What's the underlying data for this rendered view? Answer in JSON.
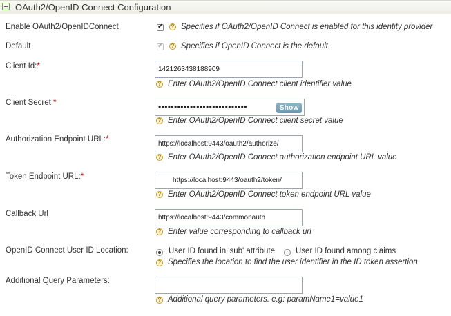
{
  "section": {
    "title": "OAuth2/OpenID Connect Configuration"
  },
  "enable": {
    "label": "Enable OAuth2/OpenIDConnect",
    "checked": true,
    "help": "Specifies if OAuth2/OpenID Connect is enabled for this identity provider"
  },
  "default": {
    "label": "Default",
    "checked": true,
    "disabled": true,
    "help": "Specifies if OpenID Connect is the default"
  },
  "client_id": {
    "label": "Client Id:",
    "required_mark": "*",
    "value": "1421263438188909",
    "help": "Enter OAuth2/OpenID Connect client identifier value"
  },
  "client_secret": {
    "label": "Client Secret:",
    "required_mark": "*",
    "masked_value": "••••••••••••••••••••••••••••",
    "show_label": "Show",
    "help": "Enter OAuth2/OpenID Connect client secret value"
  },
  "authorization_endpoint": {
    "label": "Authorization Endpoint URL:",
    "required_mark": "*",
    "value": "https://localhost:9443/oauth2/authorize/",
    "help": "Enter OAuth2/OpenID Connect authorization endpoint URL value"
  },
  "token_endpoint": {
    "label": "Token Endpoint URL:",
    "required_mark": "*",
    "value": "https://localhost:9443/oauth2/token/",
    "help": "Enter OAuth2/OpenID Connect token endpoint URL value"
  },
  "callback_url": {
    "label": "Callback Url",
    "value": "https://localhost:9443/commonauth",
    "help": "Enter value corresponding to callback url"
  },
  "user_id_location": {
    "label": "OpenID Connect User ID Location:",
    "options": [
      {
        "label": "User ID found in 'sub' attribute",
        "selected": true
      },
      {
        "label": "User ID found among claims",
        "selected": false
      }
    ],
    "help": "Specifies the location to find the user identifier in the ID token assertion"
  },
  "query_params": {
    "label": "Additional Query Parameters:",
    "value": "",
    "help": "Additional query parameters. e.g: paramName1=value1"
  },
  "icons": {
    "help": "help-icon",
    "collapse": "collapse-icon"
  }
}
